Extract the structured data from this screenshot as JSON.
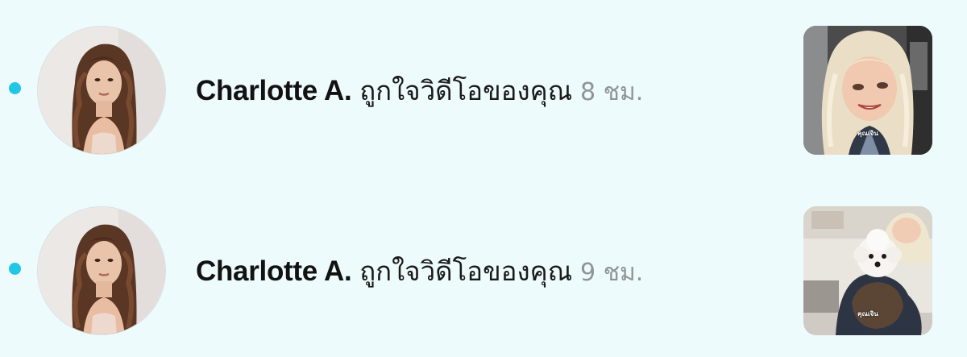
{
  "notifications": [
    {
      "unread": true,
      "user_name": "Charlotte A.",
      "action_text": "ถูกใจวิดีโอของคุณ",
      "time": "8 ชม.",
      "thumbnail_caption": "คุณเจิน",
      "avatar_icon": "profile-photo",
      "thumbnail_icon": "video-thumbnail"
    },
    {
      "unread": true,
      "user_name": "Charlotte A.",
      "action_text": "ถูกใจวิดีโอของคุณ",
      "time": "9 ชม.",
      "thumbnail_caption": "คุณเจิน",
      "avatar_icon": "profile-photo",
      "thumbnail_icon": "video-thumbnail"
    }
  ],
  "colors": {
    "background": "#eefbfd",
    "unread_dot": "#1fc6e6",
    "name_text": "#121212",
    "time_text": "#8f9596"
  }
}
